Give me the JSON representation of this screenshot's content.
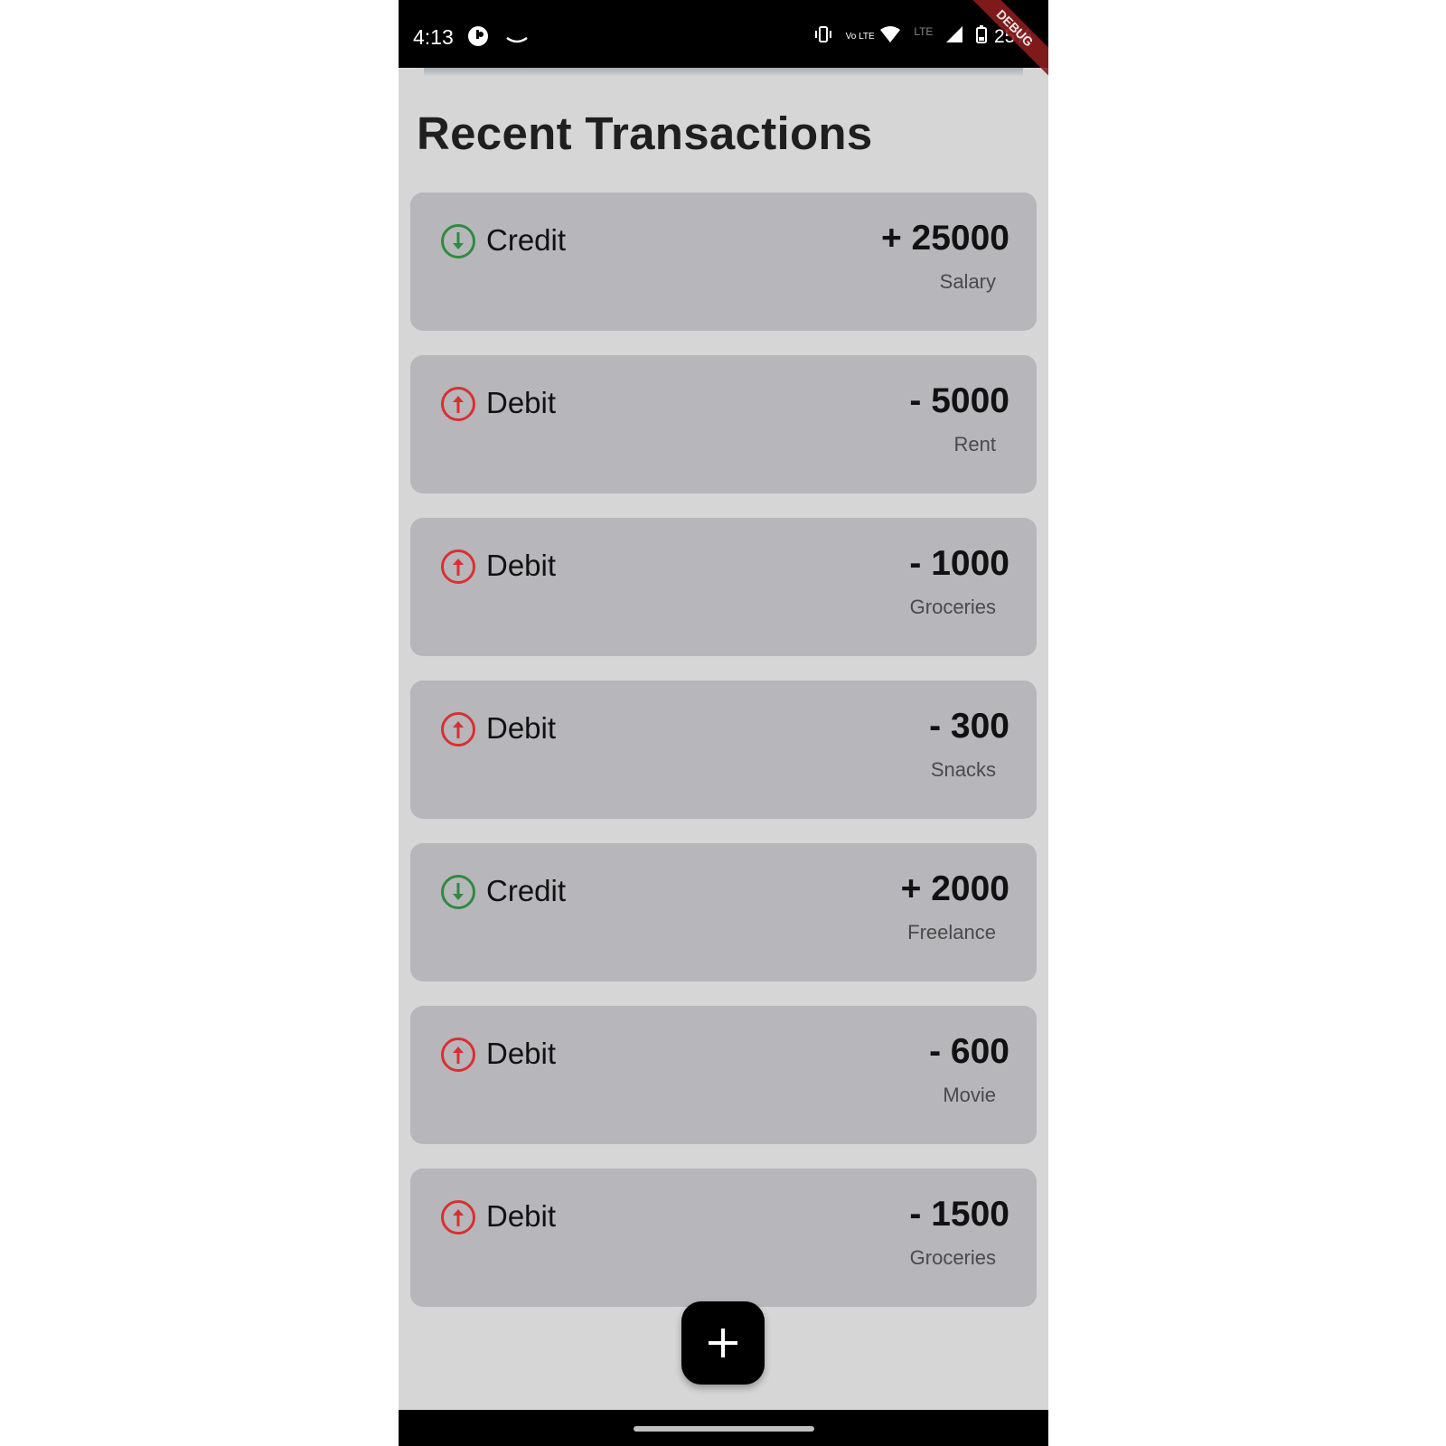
{
  "status_bar": {
    "time": "4:13",
    "battery": "25%",
    "lte_label": "LTE",
    "volte_label": "Vo LTE",
    "debug_banner": "DEBUG"
  },
  "page": {
    "title": "Recent Transactions"
  },
  "colors": {
    "credit": "#2e8b3e",
    "debit": "#d9302f"
  },
  "transactions": [
    {
      "type": "Credit",
      "icon": "arrow-down-circle-icon",
      "amount": "+ 25000",
      "category": "Salary"
    },
    {
      "type": "Debit",
      "icon": "arrow-up-circle-icon",
      "amount": "- 5000",
      "category": "Rent"
    },
    {
      "type": "Debit",
      "icon": "arrow-up-circle-icon",
      "amount": "- 1000",
      "category": "Groceries"
    },
    {
      "type": "Debit",
      "icon": "arrow-up-circle-icon",
      "amount": "- 300",
      "category": "Snacks"
    },
    {
      "type": "Credit",
      "icon": "arrow-down-circle-icon",
      "amount": "+ 2000",
      "category": "Freelance"
    },
    {
      "type": "Debit",
      "icon": "arrow-up-circle-icon",
      "amount": "- 600",
      "category": "Movie"
    },
    {
      "type": "Debit",
      "icon": "arrow-up-circle-icon",
      "amount": "- 1500",
      "category": "Groceries"
    }
  ],
  "fab": {
    "icon": "plus-icon"
  }
}
